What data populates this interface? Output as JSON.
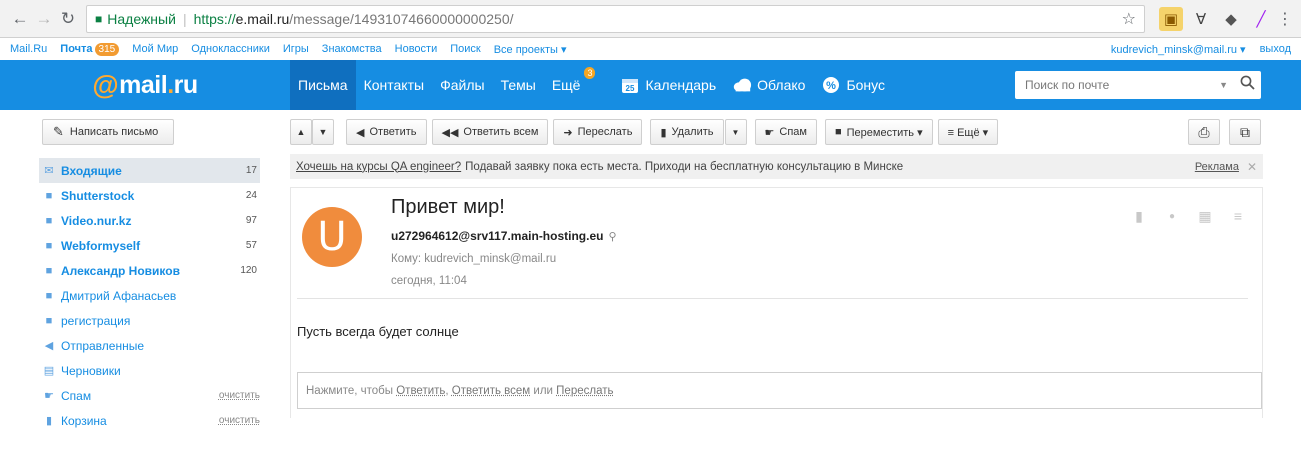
{
  "browser": {
    "secure_label": "Надежный",
    "url_scheme": "https://",
    "url_host": "e.mail.ru",
    "url_path": "/message/14931074660000000250/"
  },
  "portal": {
    "links": [
      "Mail.Ru",
      "Почта",
      "Мой Мир",
      "Одноклассники",
      "Игры",
      "Знакомства",
      "Новости",
      "Поиск",
      "Все проекты ▾"
    ],
    "mail_count": "315",
    "user_email": "kudrevich_minsk@mail.ru ▾",
    "logout": "выход"
  },
  "header": {
    "logo_at": "@",
    "logo_name": "mail",
    "logo_dot": ".",
    "logo_tld": "ru",
    "tabs": [
      "Письма",
      "Контакты",
      "Файлы",
      "Темы",
      "Ещё"
    ],
    "more_badge": "3",
    "calendar_day": "25",
    "calendar": "Календарь",
    "cloud": "Облако",
    "bonus": "Бонус",
    "search_placeholder": "Поиск по почте"
  },
  "toolbar": {
    "compose": "Написать письмо",
    "reply": "Ответить",
    "reply_all": "Ответить всем",
    "forward": "Переслать",
    "delete": "Удалить",
    "spam": "Спам",
    "move": "Переместить ▾",
    "more": "≡ Ещё ▾"
  },
  "folders": [
    {
      "name": "Входящие",
      "count": "17",
      "bold": true,
      "icon": "✉"
    },
    {
      "name": "Shutterstock",
      "count": "24",
      "bold": true,
      "icon": "■"
    },
    {
      "name": "Video.nur.kz",
      "count": "97",
      "bold": true,
      "icon": "■"
    },
    {
      "name": "Webformyself",
      "count": "57",
      "bold": true,
      "icon": "■"
    },
    {
      "name": "Александр Новиков",
      "count": "120",
      "bold": true,
      "icon": "■"
    },
    {
      "name": "Дмитрий Афанасьев",
      "count": "",
      "bold": false,
      "icon": "■"
    },
    {
      "name": "регистрация",
      "count": "",
      "bold": false,
      "icon": "■"
    },
    {
      "name": "Отправленные",
      "count": "",
      "bold": false,
      "icon": "◀"
    },
    {
      "name": "Черновики",
      "count": "",
      "bold": false,
      "icon": "▤"
    },
    {
      "name": "Спам",
      "count": "",
      "bold": false,
      "icon": "☛",
      "action": "очистить"
    },
    {
      "name": "Корзина",
      "count": "",
      "bold": false,
      "icon": "▮",
      "action": "очистить"
    }
  ],
  "ad": {
    "link": "Хочешь на курсы QA engineer?",
    "text": "Подавай заявку пока есть места. Приходи на бесплатную консультацию в Минске",
    "label": "Реклама"
  },
  "message": {
    "avatar_letter": "U",
    "subject": "Привет мир!",
    "from": "u272964612@srv117.main-hosting.eu",
    "to": "Кому: kudrevich_minsk@mail.ru",
    "time": "сегодня, 11:04",
    "body": "Пусть всегда будет солнце"
  },
  "reply_prompt": {
    "prefix": "Нажмите, чтобы",
    "reply": "Ответить",
    "comma": ",",
    "reply_all": "Ответить всем",
    "or": "или",
    "forward": "Переслать"
  }
}
